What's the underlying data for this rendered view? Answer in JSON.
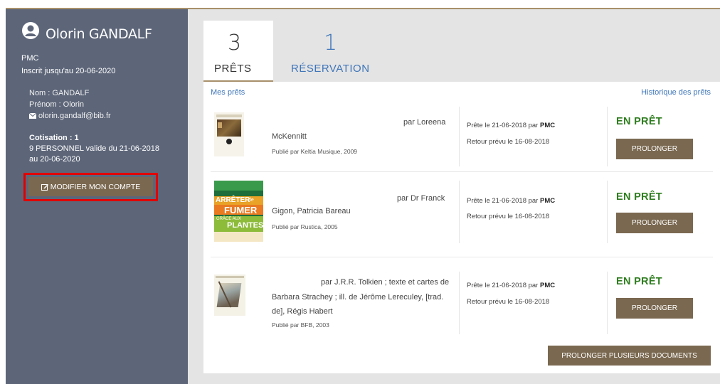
{
  "user": {
    "name": "Olorin GANDALF",
    "library": "PMC",
    "registered_until": "Inscrit jusqu'au 20-06-2020",
    "last_name": "Nom : GANDALF",
    "first_name": "Prénom : Olorin",
    "email": "olorin.gandalf@bib.fr",
    "cotisation_title": "Cotisation : 1",
    "cotisation_line1": "9 PERSONNEL valide du 21-06-2018",
    "cotisation_line2": "au 20-06-2020",
    "modify_button": "MODIFIER MON COMPTE"
  },
  "tabs": [
    {
      "count": "3",
      "label": "PRÊTS",
      "active": true
    },
    {
      "count": "1",
      "label": "RÉSERVATION",
      "active": false
    }
  ],
  "panel": {
    "title": "Mes prêts",
    "history_link": "Historique des prêts",
    "prolong_multiple": "PROLONGER PLUSIEURS DOCUMENTS"
  },
  "loans": [
    {
      "author_line1": "par Loreena",
      "author_line2": "McKennitt",
      "author_line3": "",
      "author_line4": "",
      "publisher": "Publié par Keltia Musique, 2009",
      "loaned": "Prête le 21-06-2018 par ",
      "loaned_by": "PMC",
      "return": "Retour prévu le 16-08-2018",
      "status": "EN PRÊT",
      "action": "PROLONGER",
      "cover_text": [
        "Loreena McKennitt"
      ]
    },
    {
      "author_line1": "par Dr Franck",
      "author_line2": "Gigon, Patricia Bareau",
      "author_line3": "",
      "author_line4": "",
      "publisher": "Publié par Rustica, 2005",
      "loaned": "Prête le 21-06-2018 par ",
      "loaned_by": "PMC",
      "return": "Retour prévu le 16-08-2018",
      "status": "EN PRÊT",
      "action": "PROLONGER",
      "cover_text": [
        "ARRÊTER",
        "de",
        "FUMER",
        "GRÂCE AUX",
        "PLANTES"
      ]
    },
    {
      "author_line1": "par J.R.R. Tolkien ; texte et cartes de",
      "author_line2": "Barbara Strachey ; ill. de Jérôme Lereculey, [trad.",
      "author_line3": "de], Régis Habert",
      "author_line4": "",
      "publisher": "Publié par BFB, 2003",
      "loaned": "Prête le 21-06-2018 par ",
      "loaned_by": "PMC",
      "return": "Retour prévu le 16-08-2018",
      "status": "EN PRÊT",
      "action": "PROLONGER",
      "cover_text": []
    }
  ],
  "colors": {
    "sidebar": "#5d6679",
    "accent_brown": "#7a6850",
    "link_blue": "#3f76ba",
    "status_green": "#2e7d1f",
    "highlight_red": "#e10000"
  },
  "icons": [
    "user-circle-icon",
    "envelope-icon",
    "edit-icon"
  ]
}
